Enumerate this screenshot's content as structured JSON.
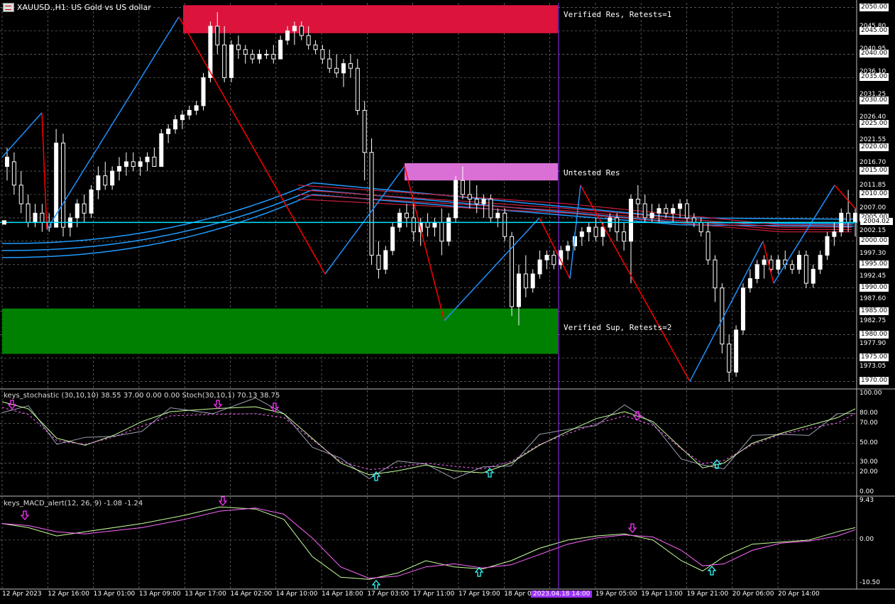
{
  "window": {
    "title": "XAUUSD.,H1:  US Gold vs US dollar"
  },
  "zones": {
    "res1_label": "Verified Res, Retests=1",
    "res2_label": "Untested Res",
    "sup_label": "Verified Sup, Retests=2"
  },
  "indicators": {
    "stoch_label": "keys_stochastic (30,10,10) 38.55 37.00 0.00 0.00 Stoch(30,10,1) 70.13 38.75",
    "macd_label": "keys_MACD_alert(12, 26, 9) -1.08 -1.24"
  },
  "price_axis": {
    "labels": [
      "2050.00",
      "2045.80",
      "2045.00",
      "2040.95",
      "2040.00",
      "2036.10",
      "2035.00",
      "2031.25",
      "2030.00",
      "2026.40",
      "2025.00",
      "2021.55",
      "2020.00",
      "2016.70",
      "2015.00",
      "2011.85",
      "2010.00",
      "2007.00",
      "2005.00",
      "2004.02",
      "2002.15",
      "2000.00",
      "1997.30",
      "1995.00",
      "1992.45",
      "1990.00",
      "1987.60",
      "1985.00",
      "1982.75",
      "1980.00",
      "1977.90",
      "1975.00",
      "1973.05",
      "1970.00"
    ],
    "current": "2004.02"
  },
  "stoch_axis": {
    "labels": [
      "100.00",
      "80.00",
      "70.00",
      "50.00",
      "30.00",
      "20.00",
      "0.00"
    ]
  },
  "macd_axis": {
    "labels": [
      "9.43",
      "0.00",
      "-10.50"
    ]
  },
  "time_axis": {
    "labels": [
      "12 Apr 2023",
      "12 Apr 16:00",
      "13 Apr 01:00",
      "13 Apr 09:00",
      "13 Apr 17:00",
      "14 Apr 02:00",
      "14 Apr 10:00",
      "14 Apr 18:00",
      "17 Apr 03:00",
      "17 Apr 11:00",
      "17 Apr 19:00",
      "18 Apr 04:00",
      "18 Apr 20:00",
      "19 Apr 05:00",
      "19 Apr 13:00",
      "19 Apr 21:00",
      "20 Apr 06:00",
      "20 Apr 14:00"
    ],
    "cursor_label": "2023.04.18 14:00"
  },
  "colors": {
    "bull": "#ffffff",
    "bear": "#ffffff",
    "res_verified": "#dc143c",
    "res_untested": "#da70d6",
    "sup_verified": "#008000",
    "zigzag_up": "#1e90ff",
    "zigzag_down": "#ff0000",
    "ma_blue": "#1e9bff",
    "ma_red": "#c8203c",
    "current_line": "#00e5ff",
    "cursor": "#9b30ff",
    "grid": "#888888"
  },
  "chart_data": {
    "type": "candlestick",
    "ylim": [
      1969,
      2051
    ],
    "candles": [
      [
        2016,
        2020,
        2013,
        2018
      ],
      [
        2017,
        2019,
        2010,
        2012
      ],
      [
        2012,
        2015,
        2006,
        2008
      ],
      [
        2008,
        2010,
        2003,
        2004
      ],
      [
        2004,
        2008,
        2003,
        2006
      ],
      [
        2006,
        2008,
        2002,
        2004
      ],
      [
        2004,
        2006,
        2002,
        2003
      ],
      [
        2003,
        2024,
        2003,
        2021
      ],
      [
        2021,
        2023,
        2001,
        2003
      ],
      [
        2003,
        2006,
        2001,
        2005
      ],
      [
        2005,
        2009,
        2003,
        2008
      ],
      [
        2008,
        2010,
        2004,
        2006
      ],
      [
        2006,
        2012,
        2005,
        2011
      ],
      [
        2011,
        2016,
        2009,
        2014
      ],
      [
        2014,
        2017,
        2011,
        2012
      ],
      [
        2012,
        2016,
        2011,
        2015
      ],
      [
        2015,
        2018,
        2013,
        2016
      ],
      [
        2016,
        2019,
        2014,
        2017
      ],
      [
        2017,
        2019,
        2015,
        2016
      ],
      [
        2016,
        2018,
        2014,
        2017
      ],
      [
        2017,
        2019,
        2015,
        2018
      ],
      [
        2018,
        2020,
        2016,
        2016
      ],
      [
        2016,
        2024,
        2016,
        2023
      ],
      [
        2023,
        2025,
        2021,
        2024
      ],
      [
        2024,
        2027,
        2023,
        2026
      ],
      [
        2026,
        2028,
        2024,
        2027
      ],
      [
        2027,
        2029,
        2026,
        2028
      ],
      [
        2028,
        2030,
        2027,
        2029
      ],
      [
        2029,
        2036,
        2028,
        2035
      ],
      [
        2035,
        2047,
        2034,
        2046
      ],
      [
        2046,
        2049,
        2040,
        2042
      ],
      [
        2042,
        2046,
        2034,
        2035
      ],
      [
        2035,
        2043,
        2034,
        2042
      ],
      [
        2042,
        2044,
        2039,
        2041
      ],
      [
        2041,
        2042,
        2038,
        2040
      ],
      [
        2040,
        2041,
        2038,
        2039
      ],
      [
        2039,
        2041,
        2038,
        2040
      ],
      [
        2040,
        2041,
        2039,
        2040
      ],
      [
        2040,
        2042,
        2038,
        2039
      ],
      [
        2039,
        2044,
        2039,
        2043
      ],
      [
        2043,
        2046,
        2042,
        2045
      ],
      [
        2045,
        2047,
        2042,
        2046
      ],
      [
        2046,
        2047,
        2043,
        2044
      ],
      [
        2044,
        2046,
        2041,
        2042
      ],
      [
        2042,
        2043,
        2040,
        2041
      ],
      [
        2041,
        2042,
        2038,
        2039
      ],
      [
        2039,
        2041,
        2036,
        2037
      ],
      [
        2037,
        2040,
        2035,
        2036
      ],
      [
        2036,
        2039,
        2033,
        2038
      ],
      [
        2038,
        2040,
        2035,
        2037
      ],
      [
        2037,
        2039,
        2027,
        2028
      ],
      [
        2028,
        2030,
        2013,
        2019
      ],
      [
        2019,
        2022,
        1995,
        1997
      ],
      [
        1997,
        2000,
        1992,
        1994
      ],
      [
        1994,
        1999,
        1993,
        1998
      ],
      [
        1998,
        2004,
        1997,
        2003
      ],
      [
        2003,
        2007,
        2002,
        2006
      ],
      [
        2006,
        2008,
        2003,
        2005
      ],
      [
        2005,
        2008,
        2000,
        2002
      ],
      [
        2002,
        2005,
        1999,
        2004
      ],
      [
        2004,
        2006,
        2001,
        2003
      ],
      [
        2003,
        2005,
        2001,
        2004
      ],
      [
        2004,
        2007,
        1997,
        2000
      ],
      [
        2000,
        2006,
        1999,
        2005
      ],
      [
        2005,
        2014,
        2004,
        2013
      ],
      [
        2013,
        2016,
        2009,
        2010
      ],
      [
        2010,
        2013,
        2007,
        2009
      ],
      [
        2009,
        2012,
        2006,
        2008
      ],
      [
        2008,
        2010,
        2005,
        2009
      ],
      [
        2009,
        2010,
        2004,
        2005
      ],
      [
        2005,
        2007,
        2003,
        2006
      ],
      [
        2006,
        2007,
        2000,
        2001
      ],
      [
        2001,
        2002,
        1984,
        1986
      ],
      [
        1986,
        1995,
        1982,
        1993
      ],
      [
        1993,
        1997,
        1988,
        1990
      ],
      [
        1990,
        1994,
        1989,
        1993
      ],
      [
        1993,
        1998,
        1992,
        1996
      ],
      [
        1996,
        1998,
        1994,
        1997
      ],
      [
        1997,
        1998,
        1994,
        1995
      ],
      [
        1995,
        1999,
        1994,
        1998
      ],
      [
        1998,
        2000,
        1996,
        1999
      ],
      [
        1999,
        2002,
        1998,
        2001
      ],
      [
        2001,
        2003,
        1999,
        2002
      ],
      [
        2002,
        2004,
        2000,
        2003
      ],
      [
        2003,
        2005,
        2000,
        2001
      ],
      [
        2001,
        2004,
        1999,
        2003
      ],
      [
        2003,
        2006,
        2002,
        2005
      ],
      [
        2005,
        2006,
        2000,
        2002
      ],
      [
        2002,
        2004,
        1998,
        2000
      ],
      [
        2000,
        2010,
        1991,
        2009
      ],
      [
        2009,
        2012,
        2005,
        2008
      ],
      [
        2008,
        2010,
        2004,
        2005
      ],
      [
        2005,
        2008,
        2004,
        2006
      ],
      [
        2006,
        2008,
        2004,
        2007
      ],
      [
        2007,
        2008,
        2005,
        2006
      ],
      [
        2006,
        2008,
        2004,
        2007
      ],
      [
        2007,
        2009,
        2005,
        2008
      ],
      [
        2008,
        2009,
        2004,
        2005
      ],
      [
        2005,
        2006,
        2003,
        2004
      ],
      [
        2004,
        2005,
        2001,
        2002
      ],
      [
        2002,
        2004,
        1995,
        1996
      ],
      [
        1996,
        1997,
        1987,
        1990
      ],
      [
        1990,
        1991,
        1976,
        1978
      ],
      [
        1978,
        1980,
        1970,
        1972
      ],
      [
        1972,
        1982,
        1971,
        1981
      ],
      [
        1981,
        1991,
        1980,
        1990
      ],
      [
        1990,
        1994,
        1989,
        1992
      ],
      [
        1992,
        1996,
        1991,
        1995
      ],
      [
        1995,
        1997,
        1992,
        1996
      ],
      [
        1996,
        1997,
        1993,
        1994
      ],
      [
        1994,
        1997,
        1993,
        1996
      ],
      [
        1996,
        1998,
        1994,
        1995
      ],
      [
        1995,
        1996,
        1993,
        1994
      ],
      [
        1994,
        1998,
        1993,
        1997
      ],
      [
        1997,
        1998,
        1990,
        1991
      ],
      [
        1991,
        1995,
        1990,
        1994
      ],
      [
        1994,
        1998,
        1993,
        1997
      ],
      [
        1997,
        2002,
        1996,
        2001
      ],
      [
        2001,
        2004,
        1999,
        2002
      ],
      [
        2002,
        2007,
        2001,
        2006
      ],
      [
        2006,
        2011,
        2002,
        2004
      ],
      [
        2004,
        2007,
        2001,
        2006
      ]
    ],
    "current_price": 2004.02
  }
}
